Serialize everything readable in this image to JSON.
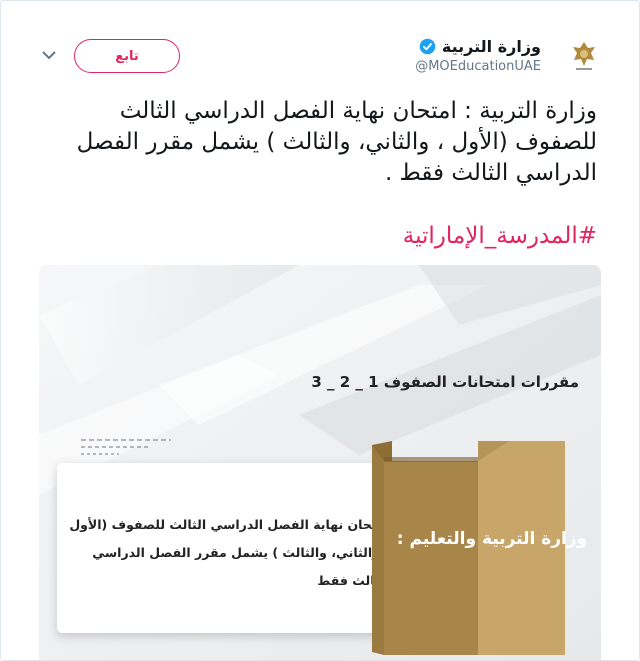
{
  "header": {
    "follow_label": "تابع",
    "account_name": "وزارة التربية",
    "account_handle": "@MOEducationUAE",
    "menu_icon": "chevron-down-icon",
    "verified_icon": "verified-badge-icon",
    "avatar_icon": "uae-emblem-logo"
  },
  "tweet": {
    "text": "وزارة التربية : امتحان نهاية الفصل الدراسي الثالث للصفوف (الأول ، والثاني، والثالث ) يشمل مقرر الفصل الدراسي الثالث فقط .",
    "hashtag": "#المدرسة_الإماراتية"
  },
  "media": {
    "heading": "مقررات امتحانات الصفوف 1 _ 2 _ 3",
    "card_text": "امتحان نهاية الفصل الدراسي الثالث للصفوف (الأول ، والثاني، والثالث ) يشمل مقرر الفصل الدراسي الثالث فقط",
    "box_label": "وزارة التربية والتعليم :"
  },
  "colors": {
    "accent": "#e0245e",
    "verified": "#1da1f2",
    "gold_dark": "#a8864a",
    "gold_light": "#c8a66a"
  }
}
